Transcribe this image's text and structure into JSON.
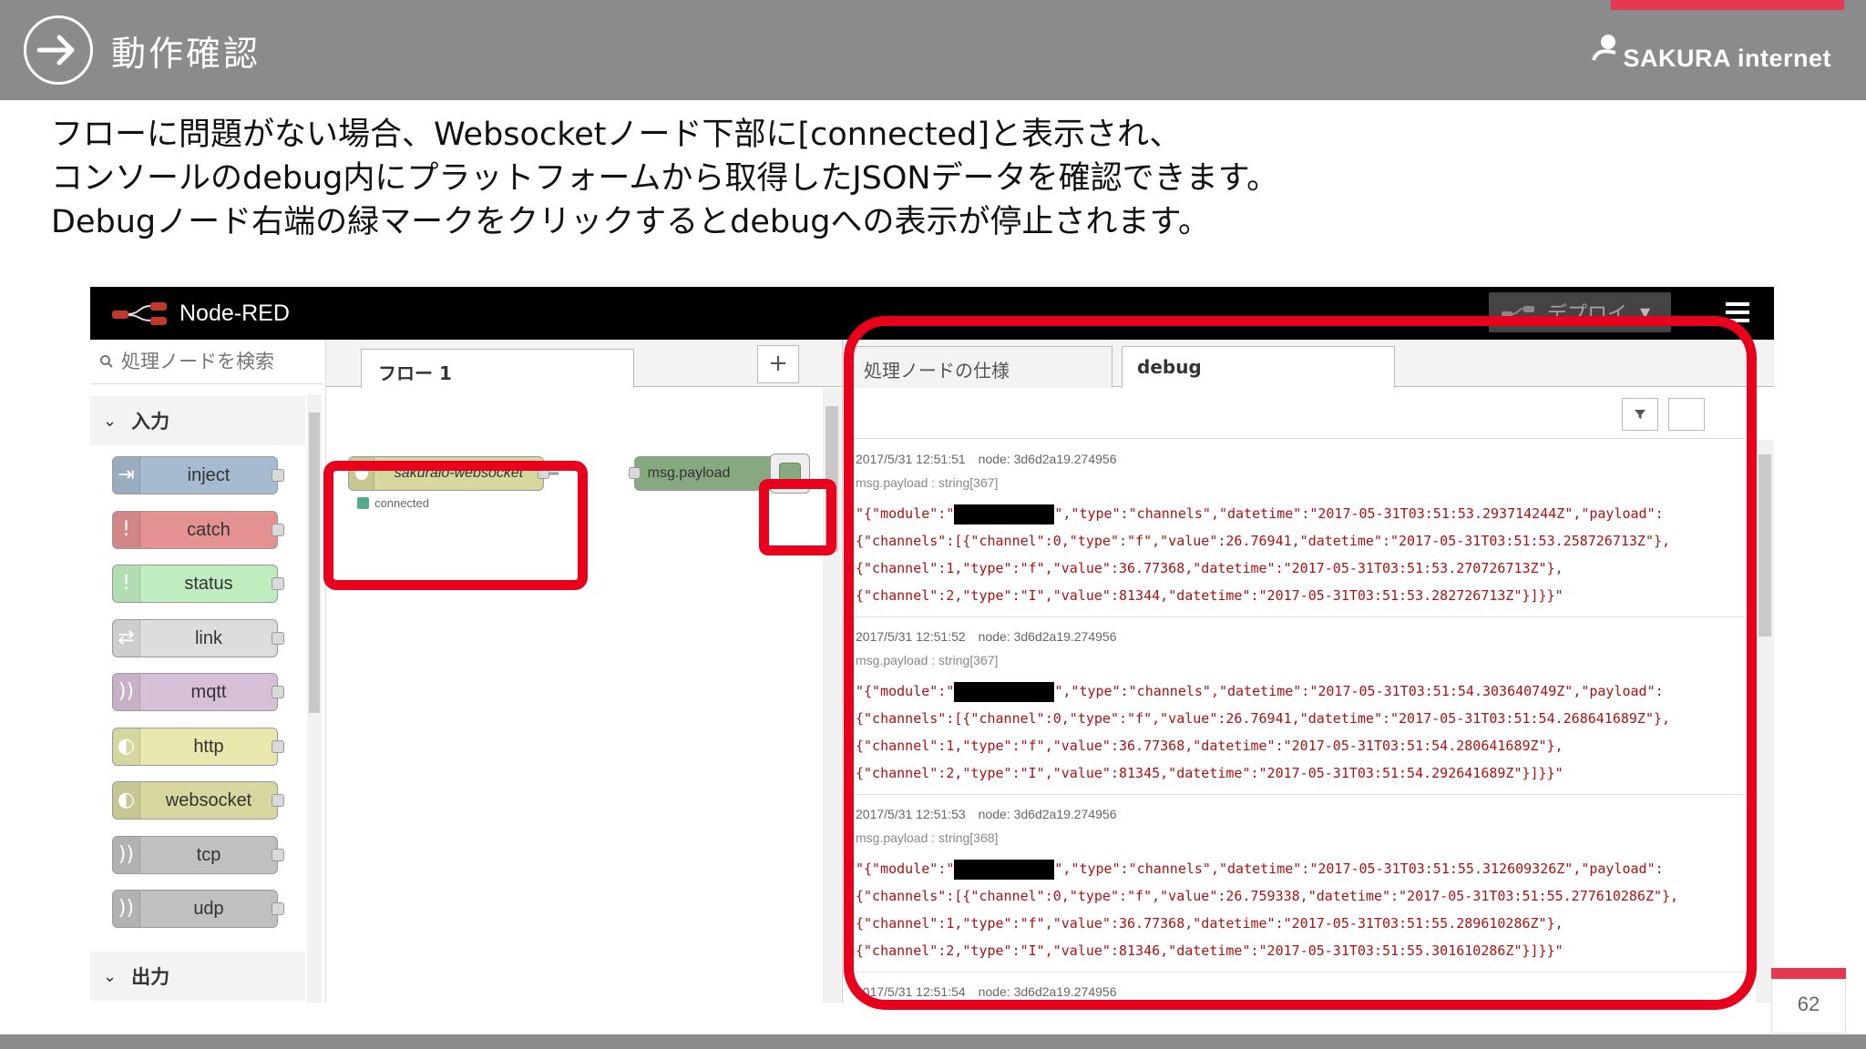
{
  "slide": {
    "title": "動作確認",
    "brand": "SAKURA internet",
    "page_number": "62",
    "description": [
      "フローに問題がない場合、Websocketノード下部に[connected]と表示され、",
      "コンソールのdebug内にプラットフォームから取得したJSONデータを確認できます。",
      "Debugノード右端の緑マークをクリックするとdebugへの表示が停止されます。"
    ]
  },
  "nodered": {
    "title": "Node-RED",
    "deploy_label": "デプロイ",
    "palette": {
      "search_placeholder": "処理ノードを検索",
      "category_input": "入力",
      "category_output": "出力",
      "nodes": [
        {
          "label": "inject",
          "color": "#a6bbcf"
        },
        {
          "label": "catch",
          "color": "#e49191"
        },
        {
          "label": "status",
          "color": "#c0edc0"
        },
        {
          "label": "link",
          "color": "#dddddd"
        },
        {
          "label": "mqtt",
          "color": "#d8bfd8"
        },
        {
          "label": "http",
          "color": "#e7e7ae"
        },
        {
          "label": "websocket",
          "color": "#d7d7a0"
        },
        {
          "label": "tcp",
          "color": "#c0c0c0"
        },
        {
          "label": "udp",
          "color": "#c0c0c0"
        }
      ]
    },
    "workspace": {
      "tab_label": "フロー 1",
      "add_label": "+",
      "ws_node_label": "sakuraio-websocket",
      "ws_status": "connected",
      "debug_node_label": "msg.payload"
    },
    "sidebar": {
      "tab_info": "処理ノードの仕様",
      "tab_debug": "debug",
      "messages": [
        {
          "timestamp": "2017/5/31 12:51:51",
          "node": "node: 3d6d2a19.274956",
          "type": "msg.payload : string[367]",
          "line1_pre": "\"{\"module\":\"",
          "line1_post": "\",\"type\":\"channels\",\"datetime\":\"2017-05-31T03:51:53.293714244Z\",\"payload\":",
          "line2": "{\"channels\":[{\"channel\":0,\"type\":\"f\",\"value\":26.76941,\"datetime\":\"2017-05-31T03:51:53.258726713Z\"},",
          "line3": "{\"channel\":1,\"type\":\"f\",\"value\":36.77368,\"datetime\":\"2017-05-31T03:51:53.270726713Z\"},",
          "line4": "{\"channel\":2,\"type\":\"I\",\"value\":81344,\"datetime\":\"2017-05-31T03:51:53.282726713Z\"}]}}\""
        },
        {
          "timestamp": "2017/5/31 12:51:52",
          "node": "node: 3d6d2a19.274956",
          "type": "msg.payload : string[367]",
          "line1_pre": "\"{\"module\":\"",
          "line1_post": "\",\"type\":\"channels\",\"datetime\":\"2017-05-31T03:51:54.303640749Z\",\"payload\":",
          "line2": "{\"channels\":[{\"channel\":0,\"type\":\"f\",\"value\":26.76941,\"datetime\":\"2017-05-31T03:51:54.268641689Z\"},",
          "line3": "{\"channel\":1,\"type\":\"f\",\"value\":36.77368,\"datetime\":\"2017-05-31T03:51:54.280641689Z\"},",
          "line4": "{\"channel\":2,\"type\":\"I\",\"value\":81345,\"datetime\":\"2017-05-31T03:51:54.292641689Z\"}]}}\""
        },
        {
          "timestamp": "2017/5/31 12:51:53",
          "node": "node: 3d6d2a19.274956",
          "type": "msg.payload : string[368]",
          "line1_pre": "\"{\"module\":\"",
          "line1_post": "\",\"type\":\"channels\",\"datetime\":\"2017-05-31T03:51:55.312609326Z\",\"payload\":",
          "line2": "{\"channels\":[{\"channel\":0,\"type\":\"f\",\"value\":26.759338,\"datetime\":\"2017-05-31T03:51:55.277610286Z\"},",
          "line3": "{\"channel\":1,\"type\":\"f\",\"value\":36.77368,\"datetime\":\"2017-05-31T03:51:55.289610286Z\"},",
          "line4": "{\"channel\":2,\"type\":\"I\",\"value\":81346,\"datetime\":\"2017-05-31T03:51:55.301610286Z\"}]}}\""
        },
        {
          "timestamp": "2017/5/31 12:51:54",
          "node": "node: 3d6d2a19.274956"
        }
      ]
    }
  },
  "colors": {
    "header_gray": "#8a8b8d",
    "accent_pink": "#e8384f",
    "highlight_red": "#e8001c",
    "debug_text": "#b01010",
    "websocket_node": "#d7d7a0",
    "debug_node": "#87a980"
  },
  "icons": [
    "arrow-right-circle-icon",
    "sakura-logo-icon",
    "nodered-logo-icon",
    "search-icon",
    "chevron-down-icon",
    "hamburger-menu-icon",
    "filter-icon",
    "trash-icon"
  ]
}
